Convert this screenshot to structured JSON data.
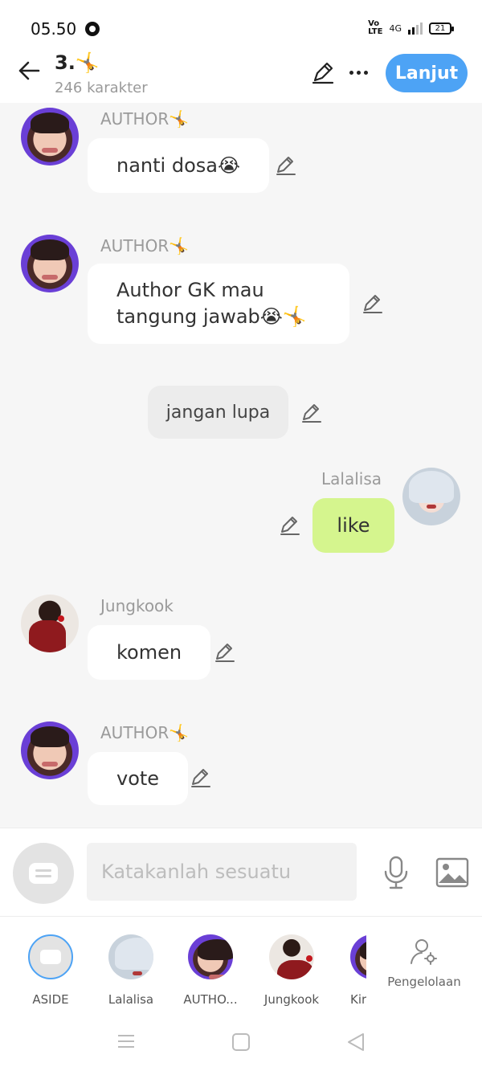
{
  "status_bar": {
    "time": "05.50",
    "network": "4G",
    "volte": "Vo\nLTE",
    "battery": "21"
  },
  "header": {
    "title": "3.🤸",
    "subtitle": "246 karakter",
    "next_label": "Lanjut"
  },
  "messages": [
    {
      "speaker": "AUTHOR🤸",
      "text": "nanti dosa😭",
      "side": "left",
      "avatar": "author"
    },
    {
      "speaker": "AUTHOR🤸",
      "text": "Author GK mau tangung jawab😭🤸",
      "side": "left",
      "avatar": "author"
    },
    {
      "speaker": "",
      "text": "jangan lupa",
      "side": "aside"
    },
    {
      "speaker": "Lalalisa",
      "text": "like",
      "side": "right",
      "avatar": "lisa"
    },
    {
      "speaker": "Jungkook",
      "text": "komen",
      "side": "left",
      "avatar": "jungkook"
    },
    {
      "speaker": "AUTHOR🤸",
      "text": "vote",
      "side": "left",
      "avatar": "author"
    }
  ],
  "input": {
    "placeholder": "Katakanlah sesuatu"
  },
  "cast": [
    {
      "label": "ASIDE",
      "avatar": "aside",
      "selected": true
    },
    {
      "label": "Lalalisa",
      "avatar": "lisa"
    },
    {
      "label": "AUTHO...",
      "avatar": "author"
    },
    {
      "label": "Jungkook",
      "avatar": "jungkook"
    },
    {
      "label": "Kir",
      "avatar": "other"
    }
  ],
  "manage": {
    "label": "Pengelolaan"
  },
  "colors": {
    "accent": "#4da3f5",
    "right_bubble": "#d5f58e",
    "background": "#f6f6f6"
  }
}
